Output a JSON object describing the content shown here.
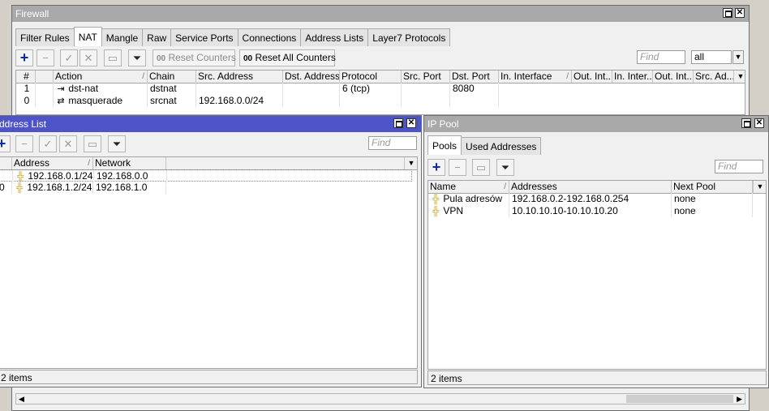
{
  "firewall": {
    "title": "Firewall",
    "tabs": [
      "Filter Rules",
      "NAT",
      "Mangle",
      "Raw",
      "Service Ports",
      "Connections",
      "Address Lists",
      "Layer7 Protocols"
    ],
    "active_tab": "NAT",
    "reset_counters": "Reset Counters",
    "reset_all_counters": "Reset All Counters",
    "counter_prefix": "00",
    "find_placeholder": "Find",
    "filter_select": "all",
    "columns": [
      "#",
      "",
      "Action",
      "Chain",
      "Src. Address",
      "Dst. Address",
      "Protocol",
      "Src. Port",
      "Dst. Port",
      "In. Interface",
      "Out. Int...",
      "In. Inter...",
      "Out. Int...",
      "Src. Ad..."
    ],
    "rows": [
      {
        "num": "1",
        "action": "dst-nat",
        "chain": "dstnat",
        "src": "",
        "dst": "",
        "protocol": "6 (tcp)",
        "sport": "",
        "dport": "8080"
      },
      {
        "num": "0",
        "action": "masquerade",
        "chain": "srcnat",
        "src": "192.168.0.0/24",
        "dst": "",
        "protocol": "",
        "sport": "",
        "dport": ""
      }
    ]
  },
  "address_list": {
    "title": "Address List",
    "title_visible": "ddress List",
    "find_placeholder": "Find",
    "columns": [
      "Address",
      "Network"
    ],
    "rows": [
      {
        "prefix": "",
        "address": "192.168.0.1/24",
        "network": "192.168.0.0"
      },
      {
        "prefix": "0",
        "address": "192.168.1.2/24",
        "network": "192.168.1.0"
      }
    ],
    "status": "2 items",
    "status_visible": "2 items"
  },
  "ip_pool": {
    "title": "IP Pool",
    "tabs": [
      "Pools",
      "Used Addresses"
    ],
    "active_tab": "Pools",
    "find_placeholder": "Find",
    "columns": [
      "Name",
      "Addresses",
      "Next Pool"
    ],
    "rows": [
      {
        "name": "Pula adresów",
        "addresses": "192.168.0.2-192.168.0.254",
        "next": "none"
      },
      {
        "name": "VPN",
        "addresses": "10.10.10.10-10.10.10.20",
        "next": "none"
      }
    ],
    "status": "2 items"
  },
  "colors": {
    "active_title": "#4e54c8",
    "inactive_title": "#a9a9a9",
    "add_icon": "#0b2bb5"
  }
}
